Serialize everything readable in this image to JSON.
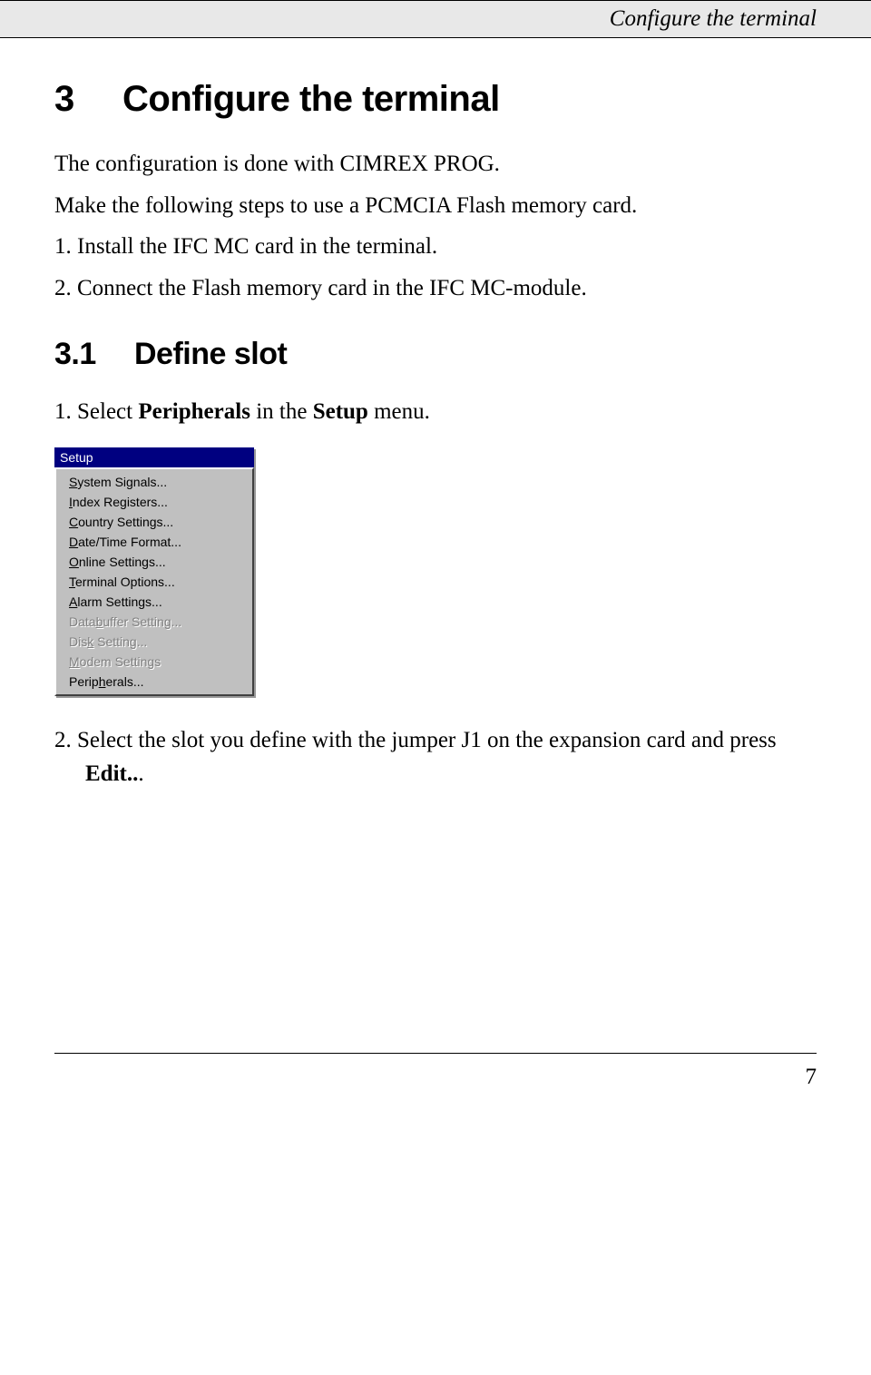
{
  "header": {
    "running_title": "Configure the terminal"
  },
  "section": {
    "number": "3",
    "title": "Configure the terminal",
    "intro1": "The configuration is done with CIMREX PROG.",
    "intro2": "Make the following steps to use a PCMCIA Flash memory card.",
    "step1_num": "1.",
    "step1_text": "Install the IFC MC card in the terminal.",
    "step2_num": "2.",
    "step2_text": "Connect the Flash memory card in the IFC MC-module."
  },
  "subsection": {
    "number": "3.1",
    "title": "Define slot",
    "step1_num": "1.",
    "step1_pre": "Select ",
    "step1_b1": "Peripherals",
    "step1_mid": " in the ",
    "step1_b2": "Setup",
    "step1_post": " menu.",
    "step2_num": "2.",
    "step2_pre": "Select the slot you define with the jumper J1 on the expansion card and press ",
    "step2_b": "Edit..",
    "step2_post": "."
  },
  "menu": {
    "title": "Setup",
    "items": [
      {
        "u": "S",
        "rest": "ystem Signals...",
        "enabled": true
      },
      {
        "u": "I",
        "rest": "ndex Registers...",
        "enabled": true
      },
      {
        "u": "C",
        "rest": "ountry Settings...",
        "enabled": true
      },
      {
        "u": "D",
        "rest": "ate/Time Format...",
        "enabled": true
      },
      {
        "u": "O",
        "rest": "nline Settings...",
        "enabled": true
      },
      {
        "u": "T",
        "rest": "erminal Options...",
        "enabled": true
      },
      {
        "u": "A",
        "rest": "larm Settings...",
        "enabled": true
      },
      {
        "pre": "Data",
        "u": "b",
        "rest": "uffer Setting...",
        "enabled": false
      },
      {
        "pre": "Dis",
        "u": "k",
        "rest": " Setting...",
        "enabled": false
      },
      {
        "u": "M",
        "rest": "odem Settings",
        "enabled": false
      },
      {
        "pre": "Perip",
        "u": "h",
        "rest": "erals...",
        "enabled": true
      }
    ]
  },
  "page_number": "7"
}
